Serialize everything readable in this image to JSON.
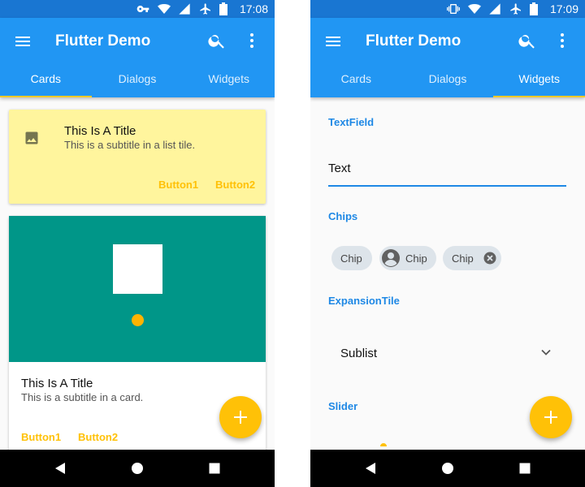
{
  "screens": [
    {
      "status_time": "17:08",
      "title": "Flutter Demo",
      "tabs": [
        "Cards",
        "Dialogs",
        "Widgets"
      ],
      "active_tab": "Cards",
      "list_card": {
        "title": "This Is A Title",
        "subtitle": "This is a subtitle in a list tile.",
        "button1": "Button1",
        "button2": "Button2"
      },
      "media_card": {
        "title": "This Is A Title",
        "subtitle": "This is a subtitle in a card.",
        "button1": "Button1",
        "button2": "Button2"
      }
    },
    {
      "status_time": "17:09",
      "title": "Flutter Demo",
      "tabs": [
        "Cards",
        "Dialogs",
        "Widgets"
      ],
      "active_tab": "Widgets",
      "sections": {
        "textfield": "TextField",
        "chips": "Chips",
        "expansion": "ExpansionTile",
        "slider": "Slider"
      },
      "text_field_value": "Text",
      "chips": [
        "Chip",
        "Chip",
        "Chip"
      ],
      "expansion_item": "Sublist"
    }
  ],
  "colors": {
    "primary": "#2196f3",
    "primary_dark": "#1976d2",
    "accent": "#ffc107",
    "list_card_bg": "#fff59d",
    "media_bg": "#009688"
  },
  "icons": [
    "menu-icon",
    "search-icon",
    "more-vert-icon",
    "image-icon",
    "add-icon",
    "account-circle-icon",
    "cancel-icon",
    "expand-more-icon",
    "back-icon",
    "home-icon",
    "recents-icon",
    "key-icon",
    "wifi-icon",
    "signal-icon",
    "airplane-icon",
    "battery-icon",
    "vibrate-icon"
  ]
}
